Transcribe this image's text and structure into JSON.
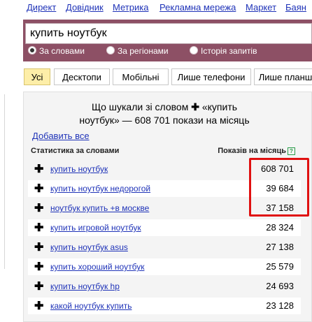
{
  "topnav": {
    "links": [
      "Директ",
      "Довідник",
      "Метрика",
      "Рекламна мережа",
      "Маркет",
      "Баян"
    ]
  },
  "search": {
    "query": "купить ноутбук",
    "options": [
      {
        "label": "За словами",
        "selected": true
      },
      {
        "label": "За регіонами",
        "selected": false
      },
      {
        "label": "Історія запитів",
        "selected": false
      }
    ]
  },
  "tabs": [
    "Усі",
    "Десктопи",
    "Мобільні",
    "Лише телефони",
    "Лише планш"
  ],
  "results": {
    "headline_line1": "Що шукали зі словом",
    "headline_quote": "«купить",
    "headline_line2": "ноутбук» — 608 701 покази на місяць",
    "add_all": "Добавить все",
    "col_phrase": "Статистика за словами",
    "col_count": "Показів на місяць",
    "help_mark": "?",
    "rows": [
      {
        "phrase": "купить ноутбук",
        "count": "608 701"
      },
      {
        "phrase": "купить ноутбук недорогой",
        "count": "39 684"
      },
      {
        "phrase": "ноутбук купить +в москве",
        "count": "37 158"
      },
      {
        "phrase": "купить игровой ноутбук",
        "count": "28 324"
      },
      {
        "phrase": "купить ноутбук asus",
        "count": "27 138"
      },
      {
        "phrase": "купить хороший ноутбук",
        "count": "25 579"
      },
      {
        "phrase": "купить ноутбук hp",
        "count": "24 693"
      },
      {
        "phrase": "какой ноутбук купить",
        "count": "23 128"
      }
    ]
  },
  "colors": {
    "accent": "#8d5065",
    "link": "#1f33b8",
    "highlight": "#e01010",
    "active_tab": "#fdeea8"
  }
}
